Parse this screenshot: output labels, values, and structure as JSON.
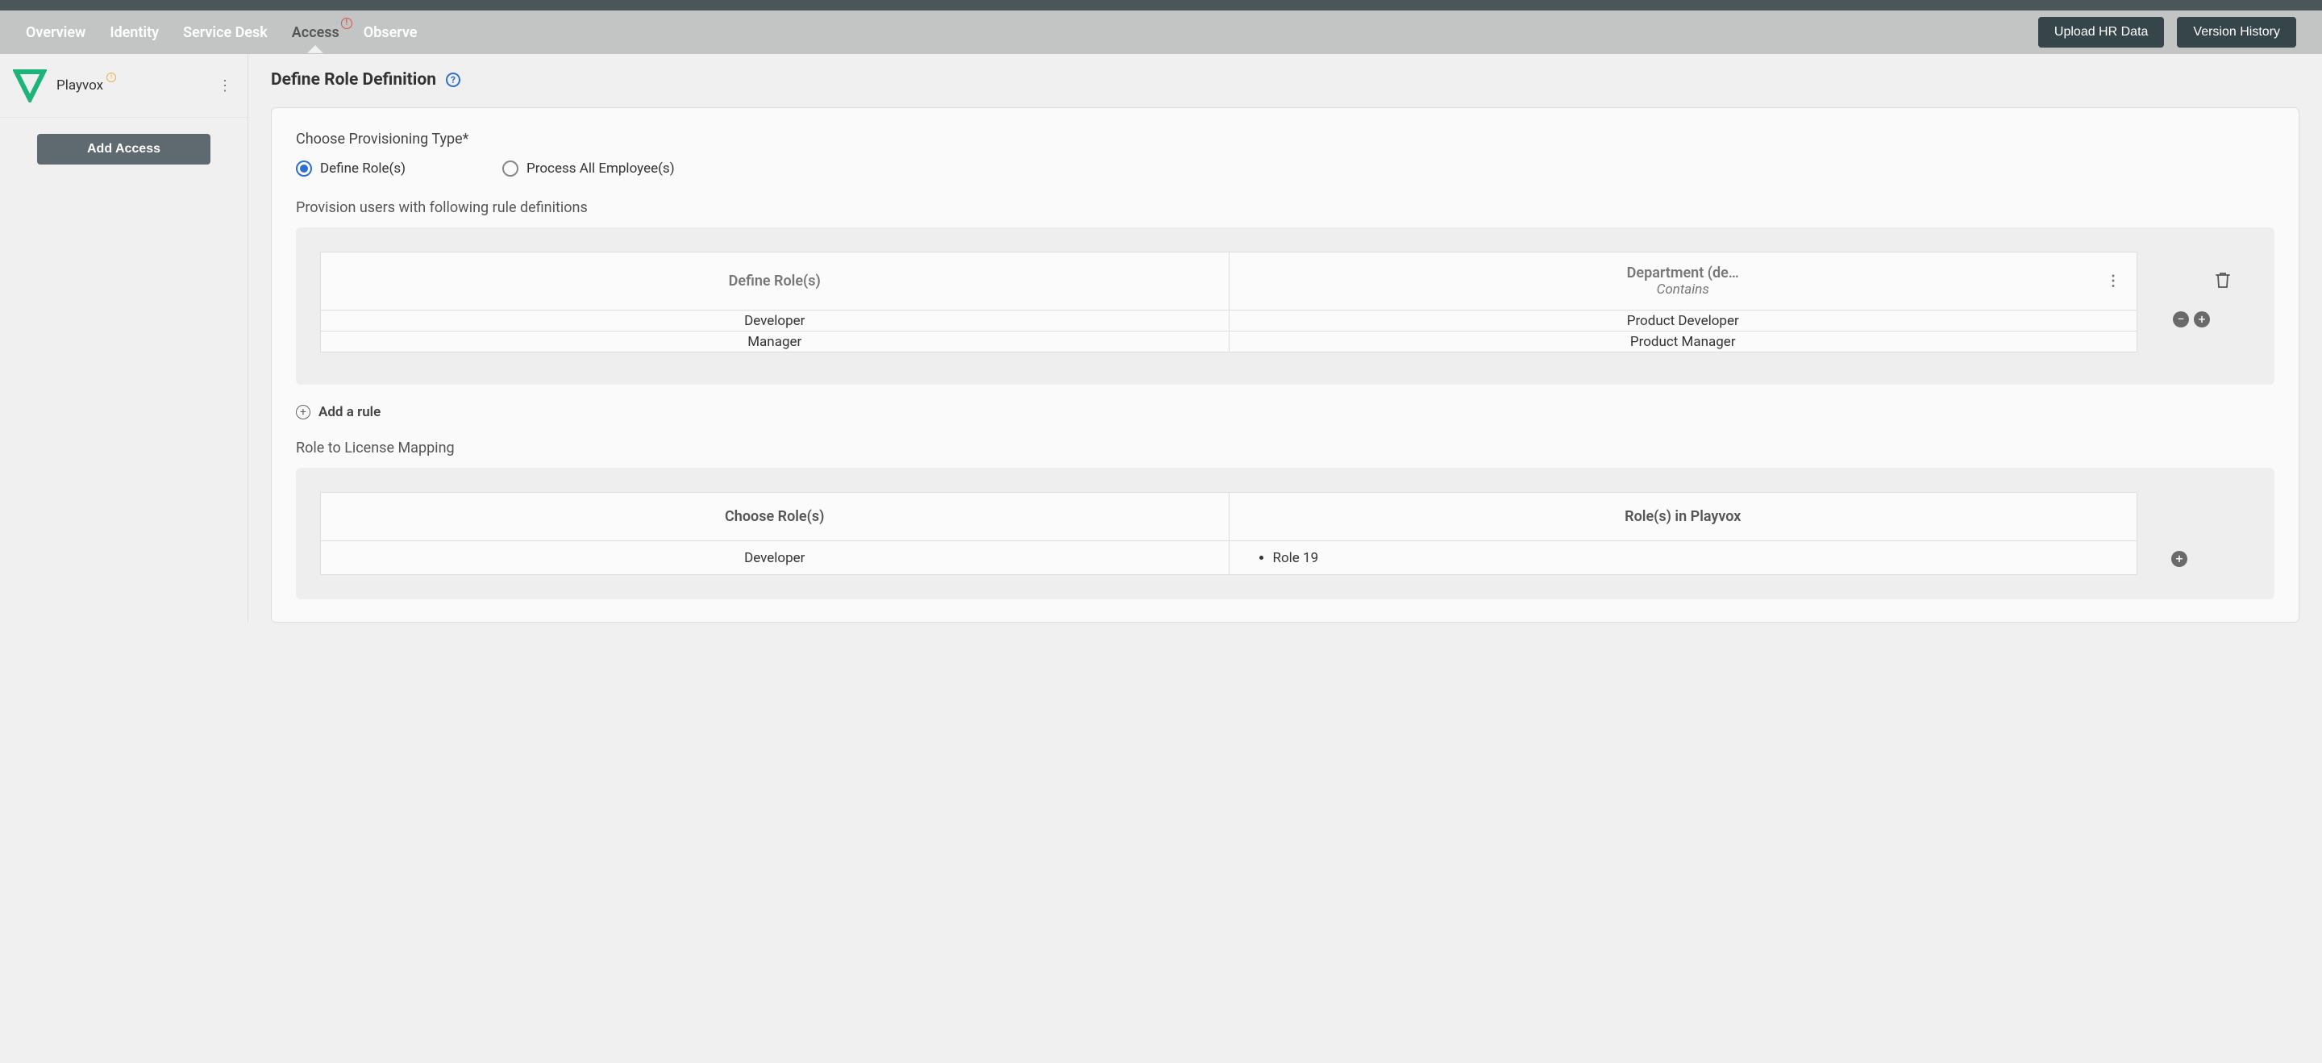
{
  "nav": {
    "tabs": [
      "Overview",
      "Identity",
      "Service Desk",
      "Access",
      "Observe"
    ],
    "active_index": 3,
    "buttons": {
      "upload": "Upload HR Data",
      "history": "Version History"
    }
  },
  "sidebar": {
    "app_name": "Playvox",
    "add_access": "Add Access"
  },
  "page": {
    "title": "Define Role Definition",
    "provisioning_label": "Choose Provisioning Type*",
    "radio": {
      "define": "Define Role(s)",
      "process_all": "Process All Employee(s)"
    },
    "rules_heading": "Provision users with following rule definitions",
    "rule_table": {
      "col1_header": "Define Role(s)",
      "col2_header": "Department (de…",
      "col2_sub": "Contains",
      "rows": [
        {
          "role": "Developer",
          "dept": "Product Developer"
        },
        {
          "role": "Manager",
          "dept": "Product Manager"
        }
      ]
    },
    "add_rule": "Add a rule",
    "mapping_heading": "Role to License Mapping",
    "mapping_table": {
      "col1_header": "Choose Role(s)",
      "col2_header": "Role(s) in Playvox",
      "rows": [
        {
          "choose": "Developer",
          "playvox_roles": [
            "Role 19"
          ]
        }
      ]
    }
  }
}
